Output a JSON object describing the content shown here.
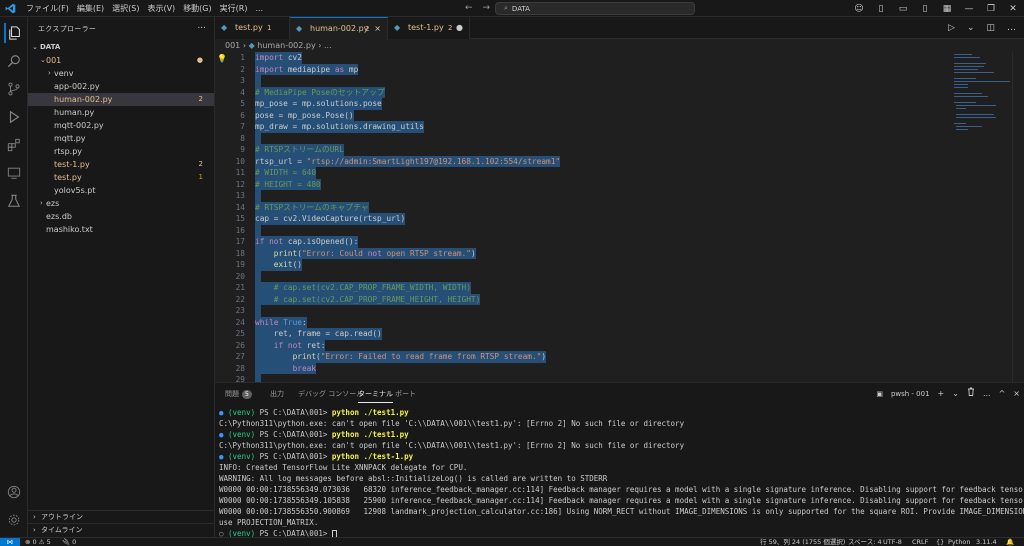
{
  "titlebar": {
    "menu": [
      "ファイル(F)",
      "編集(E)",
      "選択(S)",
      "表示(V)",
      "移動(G)",
      "実行(R)",
      "..."
    ],
    "search": "DATA"
  },
  "sidebar": {
    "title": "エクスプローラー",
    "more": "...",
    "root": "DATA",
    "tree": [
      {
        "label": "001",
        "indent": 1,
        "chevron": "⌄",
        "color": "#e2c08d",
        "badge": "●",
        "badge_color": "#e2c08d"
      },
      {
        "label": "venv",
        "indent": 2,
        "chevron": "›",
        "color": "#cccccc",
        "badge": "",
        "badge_color": ""
      },
      {
        "label": "app-002.py",
        "indent": 2,
        "chevron": "",
        "color": "#cccccc",
        "badge": "",
        "badge_color": ""
      },
      {
        "label": "human-002.py",
        "indent": 2,
        "chevron": "",
        "color": "#e2c08d",
        "badge": "2",
        "badge_color": "#e2c08d",
        "selected": true
      },
      {
        "label": "human.py",
        "indent": 2,
        "chevron": "",
        "color": "#cccccc",
        "badge": "",
        "badge_color": ""
      },
      {
        "label": "mqtt-002.py",
        "indent": 2,
        "chevron": "",
        "color": "#cccccc",
        "badge": "",
        "badge_color": ""
      },
      {
        "label": "mqtt.py",
        "indent": 2,
        "chevron": "",
        "color": "#cccccc",
        "badge": "",
        "badge_color": ""
      },
      {
        "label": "rtsp.py",
        "indent": 2,
        "chevron": "",
        "color": "#cccccc",
        "badge": "",
        "badge_color": ""
      },
      {
        "label": "test-1.py",
        "indent": 2,
        "chevron": "",
        "color": "#e2c08d",
        "badge": "2",
        "badge_color": "#e2c08d"
      },
      {
        "label": "test.py",
        "indent": 2,
        "chevron": "",
        "color": "#e2c08d",
        "badge": "1",
        "badge_color": "#cca700"
      },
      {
        "label": "yolov5s.pt",
        "indent": 2,
        "chevron": "",
        "color": "#cccccc",
        "badge": "",
        "badge_color": ""
      },
      {
        "label": "ezs",
        "indent": 1,
        "chevron": "›",
        "color": "#cccccc",
        "badge": "",
        "badge_color": ""
      },
      {
        "label": "ezs.db",
        "indent": 1,
        "chevron": "",
        "color": "#cccccc",
        "badge": "",
        "badge_color": ""
      },
      {
        "label": "mashiko.txt",
        "indent": 1,
        "chevron": "",
        "color": "#cccccc",
        "badge": "",
        "badge_color": ""
      }
    ],
    "outline": "アウトライン",
    "timeline": "タイムライン"
  },
  "tabs": [
    {
      "name": "test.py",
      "badge": "1",
      "close": "",
      "active": false
    },
    {
      "name": "human-002.py",
      "badge": "2",
      "close": "×",
      "active": true
    },
    {
      "name": "test-1.py",
      "badge": "2",
      "close": "●",
      "active": false
    }
  ],
  "breadcrumb": {
    "folder": "001",
    "sep": "›",
    "file": "human-002.py",
    "more": "› ..."
  },
  "code": [
    {
      "n": "1",
      "t": "import cv2"
    },
    {
      "n": "2",
      "t": "import mediapipe as mp"
    },
    {
      "n": "3",
      "t": ""
    },
    {
      "n": "4",
      "t": "# MediaPipe Poseのセットアップ"
    },
    {
      "n": "5",
      "t": "mp_pose = mp.solutions.pose"
    },
    {
      "n": "6",
      "t": "pose = mp_pose.Pose()"
    },
    {
      "n": "7",
      "t": "mp_draw = mp.solutions.drawing_utils"
    },
    {
      "n": "8",
      "t": ""
    },
    {
      "n": "9",
      "t": "# RTSPストリームのURL"
    },
    {
      "n": "10",
      "t": "rtsp_url = \"rtsp://admin:SmartLight197@192.168.1.102:554/stream1\""
    },
    {
      "n": "11",
      "t": "# WIDTH = 640"
    },
    {
      "n": "12",
      "t": "# HEIGHT = 480"
    },
    {
      "n": "13",
      "t": ""
    },
    {
      "n": "14",
      "t": "# RTSPストリームのキャプチャ"
    },
    {
      "n": "15",
      "t": "cap = cv2.VideoCapture(rtsp_url)"
    },
    {
      "n": "16",
      "t": ""
    },
    {
      "n": "17",
      "t": "if not cap.isOpened():"
    },
    {
      "n": "18",
      "t": "    print(\"Error: Could not open RTSP stream.\")"
    },
    {
      "n": "19",
      "t": "    exit()"
    },
    {
      "n": "20",
      "t": ""
    },
    {
      "n": "21",
      "t": "    # cap.set(cv2.CAP_PROP_FRAME_WIDTH, WIDTH)"
    },
    {
      "n": "22",
      "t": "    # cap.set(cv2.CAP_PROP_FRAME_HEIGHT, HEIGHT)"
    },
    {
      "n": "23",
      "t": ""
    },
    {
      "n": "24",
      "t": "while True:"
    },
    {
      "n": "25",
      "t": "    ret, frame = cap.read()"
    },
    {
      "n": "26",
      "t": "    if not ret:"
    },
    {
      "n": "27",
      "t": "        print(\"Error: Failed to read frame from RTSP stream.\")"
    },
    {
      "n": "28",
      "t": "        break"
    },
    {
      "n": "29",
      "t": ""
    }
  ],
  "panel": {
    "tabs": [
      "問題",
      "出力",
      "デバッグ コンソール",
      "ターミナル",
      "ポート"
    ],
    "problems_count": "5",
    "terminal_name": "pwsh - 001",
    "actions": [
      "+",
      "⌄",
      "🗑",
      "...",
      "^",
      "×"
    ]
  },
  "terminal": [
    {
      "dot": "●",
      "venv": "(venv)",
      "ps": " PS C:\\DATA\\001> ",
      "cmd": "python ./test1.py",
      "rest": ""
    },
    {
      "dot": "",
      "venv": "",
      "ps": "",
      "cmd": "",
      "rest": "C:\\Python311\\python.exe: can't open file 'C:\\\\DATA\\\\001\\\\test1.py': [Errno 2] No such file or directory"
    },
    {
      "dot": "●",
      "venv": "(venv)",
      "ps": " PS C:\\DATA\\001> ",
      "cmd": "python ./test1.py",
      "rest": ""
    },
    {
      "dot": "",
      "venv": "",
      "ps": "",
      "cmd": "",
      "rest": "C:\\Python311\\python.exe: can't open file 'C:\\\\DATA\\\\001\\\\test1.py': [Errno 2] No such file or directory"
    },
    {
      "dot": "●",
      "venv": "(venv)",
      "ps": " PS C:\\DATA\\001> ",
      "cmd": "python ./test-1.py",
      "rest": ""
    },
    {
      "dot": "",
      "venv": "",
      "ps": "",
      "cmd": "",
      "rest": "INFO: Created TensorFlow Lite XNNPACK delegate for CPU."
    },
    {
      "dot": "",
      "venv": "",
      "ps": "",
      "cmd": "",
      "rest": "WARNING: All log messages before absl::InitializeLog() is called are written to STDERR"
    },
    {
      "dot": "",
      "venv": "",
      "ps": "",
      "cmd": "",
      "rest": "W0000 00:00:1738556349.073036   68320 inference_feedback_manager.cc:114] Feedback manager requires a model with a single signature inference. Disabling support for feedback tensors."
    },
    {
      "dot": "",
      "venv": "",
      "ps": "",
      "cmd": "",
      "rest": "W0000 00:00:1738556349.105838   25900 inference_feedback_manager.cc:114] Feedback manager requires a model with a single signature inference. Disabling support for feedback tensors."
    },
    {
      "dot": "",
      "venv": "",
      "ps": "",
      "cmd": "",
      "rest": "W0000 00:00:1738556350.900869   12908 landmark_projection_calculator.cc:186] Using NORM_RECT without IMAGE_DIMENSIONS is only supported for the square ROI. Provide IMAGE_DIMENSIONS or"
    },
    {
      "dot": "",
      "venv": "",
      "ps": "",
      "cmd": "",
      "rest": "use PROJECTION_MATRIX."
    },
    {
      "dot": "○",
      "venv": "(venv)",
      "ps": " PS C:\\DATA\\001> ",
      "cmd": "",
      "rest": "",
      "cursor": true
    }
  ],
  "statusbar": {
    "errors": "⊗ 0 ⚠ 5",
    "ports": "🔌 0",
    "position": "行 59、列 24 (1755 個選択)",
    "spaces": "スペース: 4",
    "encoding": "UTF-8",
    "eol": "CRLF",
    "braces": "{}",
    "language": "Python",
    "version": "3.11.4"
  }
}
